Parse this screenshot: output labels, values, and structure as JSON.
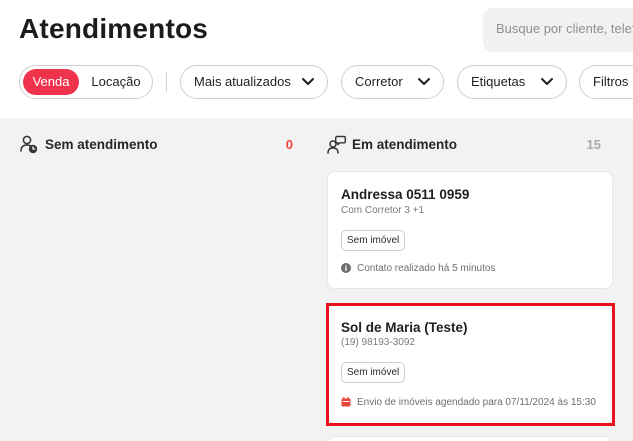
{
  "header": {
    "title": "Atendimentos",
    "search_placeholder": "Busque por cliente, telefone"
  },
  "toolbar": {
    "segment": {
      "active": "Venda",
      "inactive": "Locação"
    },
    "filters": [
      {
        "label": "Mais atualizados"
      },
      {
        "label": "Corretor"
      },
      {
        "label": "Etiquetas"
      },
      {
        "label": "Filtros"
      }
    ]
  },
  "columns": [
    {
      "label": "Sem atendimento",
      "count": "0",
      "icon": "user-clock-icon",
      "count_color": "#e8463a"
    },
    {
      "label": "Em atendimento",
      "count": "15",
      "icon": "users-chat-icon",
      "count_color": "#a9a9a9"
    }
  ],
  "cards": [
    {
      "name": "Andressa 0511 0959",
      "sub": "Com Corretor 3 +1",
      "tag": "Sem imóvel",
      "meta": "Contato realizado há 5 minutos",
      "meta_icon": "info-icon"
    },
    {
      "name": "Sol de Maria (Teste)",
      "sub": "(19) 98193-3092",
      "tag": "Sem imóvel",
      "meta": "Envio de imóveis agendado para 07/11/2024 às 15:30",
      "meta_icon": "calendar-icon",
      "highlight_color": "#e8101c"
    }
  ],
  "colors": {
    "accent": "#f0334d",
    "background": "#f2f2f2"
  }
}
